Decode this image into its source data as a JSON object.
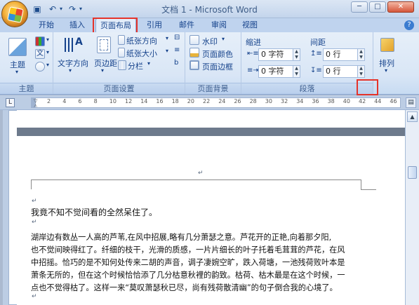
{
  "window": {
    "title": "文档 1 - Microsoft Word"
  },
  "quick_access": {
    "save_icon": "save-icon",
    "undo_icon": "undo-icon",
    "redo_icon": "redo-icon"
  },
  "tabs": [
    {
      "label": "开始"
    },
    {
      "label": "插入"
    },
    {
      "label": "页面布局"
    },
    {
      "label": "引用"
    },
    {
      "label": "邮件"
    },
    {
      "label": "审阅"
    },
    {
      "label": "视图"
    }
  ],
  "active_tab": "页面布局",
  "ribbon": {
    "theme_group": {
      "label": "主题",
      "theme_button": "主题"
    },
    "page_setup": {
      "label": "页面设置",
      "text_direction": "文字方向",
      "margins": "页边距",
      "orientation": "纸张方向",
      "size": "纸张大小",
      "columns": "分栏"
    },
    "page_background": {
      "label": "页面背景",
      "watermark": "水印",
      "page_color": "页面颜色",
      "page_borders": "页面边框"
    },
    "paragraph": {
      "label": "段落",
      "indent_label": "缩进",
      "indent_left": "0 字符",
      "indent_right": "0 字符",
      "spacing_label": "间距",
      "spacing_before": "0 行",
      "spacing_after": "0 行"
    },
    "arrange": {
      "label": "排列"
    }
  },
  "ruler": {
    "numbers": [
      "2",
      "4",
      "6",
      "8",
      "10",
      "12",
      "14",
      "16",
      "18",
      "20",
      "22",
      "24",
      "26",
      "28",
      "30",
      "32",
      "34",
      "36",
      "38",
      "40",
      "42",
      "44",
      "46"
    ]
  },
  "document": {
    "line1": "我竟不知不觉间看的全然呆住了。",
    "para": [
      "湖岸边有数丛一人高的芦苇,在风中招展,略有几分萧瑟之意。芦花开的正艳,向着那夕阳,",
      "也不觉间映得红了。纤细的枝干，光滑的质感，一片片细长的叶子托着毛茸茸的芦花，在风",
      "中招摇。恰巧的是不知何处传来二胡的声音，调子凄婉空旷，跌入荷塘，一池残荷败叶本是",
      "萧条无所的，但在这个时候恰恰添了几分枯意秋裡的韵致。枯荷、枯木最是在这个时候，一",
      "点也不觉得枯了。这样一来“莫叹萧瑟秋已尽，尚有残荷散清幽”的句子倒合我的心境了。"
    ],
    "para_mark": "↵"
  }
}
